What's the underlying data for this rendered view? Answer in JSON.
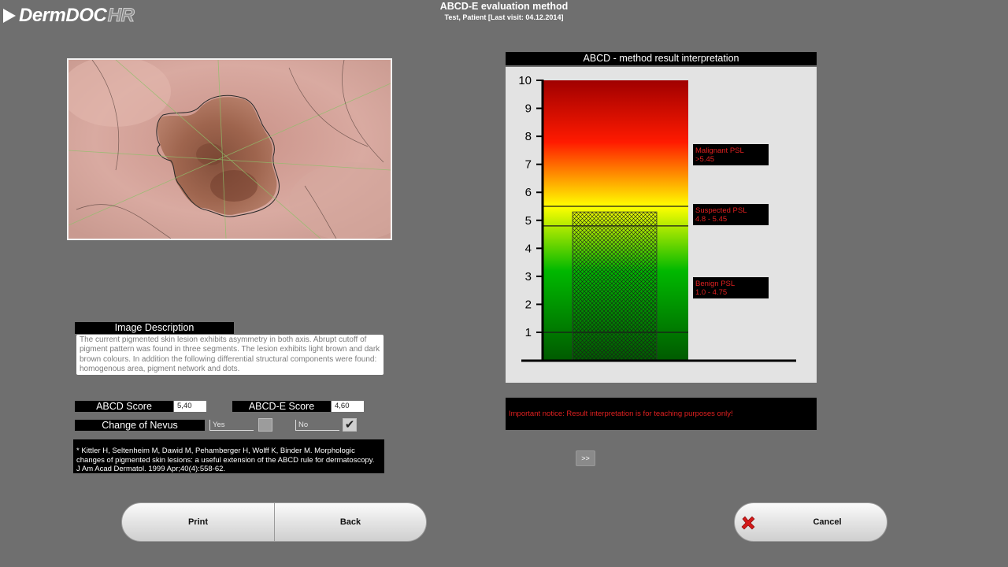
{
  "app": {
    "logo_main": "DermDOC",
    "logo_suffix": "HR"
  },
  "header": {
    "title": "ABCD-E evaluation method",
    "subtitle": "Test, Patient [Last visit: 04.12.2014]"
  },
  "image_description": {
    "label": "Image Description",
    "text": "The current pigmented skin lesion exhibits asymmetry in both axis. Abrupt cutoff of pigment pattern was found in three segments. The lesion exhibits light brown and dark brown colours. In addition the following differential structural components were found: homogenous area, pigment network and dots."
  },
  "scores": {
    "abcd_label": "ABCD Score",
    "abcd_value": "5,40",
    "abcde_label": "ABCD-E Score",
    "abcde_value": "4,60"
  },
  "nevus_change": {
    "label": "Change of Nevus",
    "yes_label": "Yes",
    "no_label": "No",
    "yes_checked": false,
    "no_checked": true
  },
  "reference": {
    "line1": "* Kittler H, Seltenheim M, Dawid M, Pehamberger H, Wolff K, Binder M. Morphologic",
    "line2": "changes of pigmented skin lesions: a useful extension of the ABCD rule for dermatoscopy.",
    "line3": "J Am Acad Dermatol. 1999 Apr;40(4):558-62."
  },
  "notice": {
    "text": "Important notice: Result interpretation is for teaching purposes only!"
  },
  "buttons": {
    "more": ">>",
    "print": "Print",
    "back": "Back",
    "cancel": "Cancel"
  },
  "colors": {
    "background": "#6f6f6f",
    "danger_text": "#e02020",
    "gradient_top": "#a00000",
    "gradient_red": "#ff1a00",
    "gradient_yellow": "#ffff00",
    "gradient_green": "#00b800",
    "gradient_bottom": "#005a00"
  },
  "chart_data": {
    "type": "bar",
    "title": "ABCD - method result interpretation",
    "ylim": [
      0,
      10
    ],
    "yticks": [
      1,
      2,
      3,
      4,
      5,
      6,
      7,
      8,
      9,
      10
    ],
    "reference_lines": [
      4.8,
      5.5,
      1.0
    ],
    "result_value": 5.3,
    "zones": [
      {
        "name": "Malignant PSL",
        "range": ">5.45"
      },
      {
        "name": "Suspected PSL",
        "range": "4.8 - 5.45"
      },
      {
        "name": "Benign PSL",
        "range": "1.0 - 4.75"
      }
    ]
  }
}
